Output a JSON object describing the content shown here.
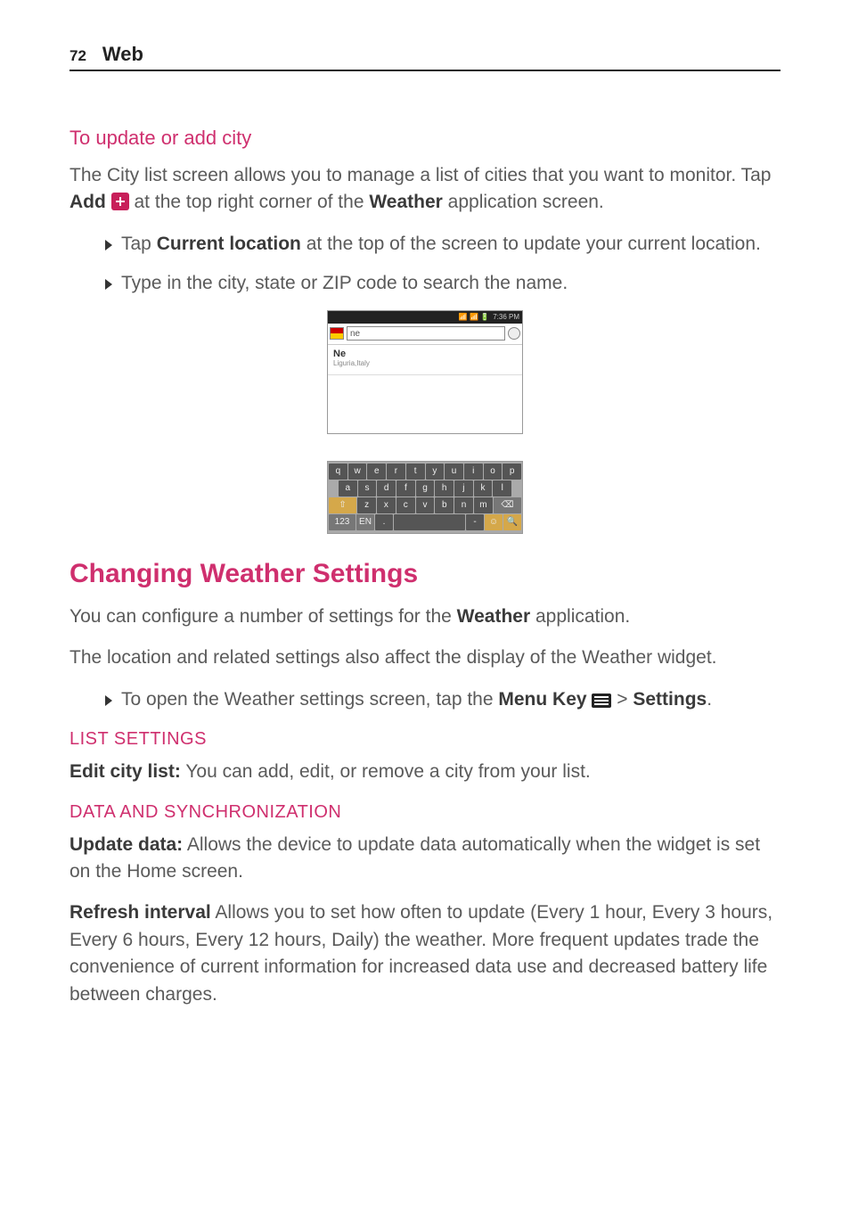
{
  "header": {
    "page_num": "72",
    "section": "Web"
  },
  "s1": {
    "title": "To update or add city",
    "p1a": "The City list screen allows you to manage a list of cities that you want to monitor. Tap ",
    "p1b": "Add",
    "p1c": " at the top right corner of the ",
    "p1d": "Weather",
    "p1e": " application screen.",
    "b1a": "Tap ",
    "b1b": "Current location",
    "b1c": " at the top of the screen to update your current location.",
    "b2": "Type in the city, state or ZIP code to search the name."
  },
  "shot": {
    "time": "7:36 PM",
    "search_val": "ne",
    "result_title": "Ne",
    "result_sub": "Liguria,Italy",
    "keys_r1": [
      "q",
      "w",
      "e",
      "r",
      "t",
      "y",
      "u",
      "i",
      "o",
      "p"
    ],
    "keys_r2": [
      "a",
      "s",
      "d",
      "f",
      "g",
      "h",
      "j",
      "k",
      "l"
    ],
    "keys_r3": [
      "⇧",
      "z",
      "x",
      "c",
      "v",
      "b",
      "n",
      "m",
      "⌫"
    ],
    "keys_r4": [
      "123",
      "EN",
      ".",
      "",
      "-",
      "☺",
      "🔍"
    ]
  },
  "s2": {
    "title": "Changing Weather Settings",
    "p1a": "You can configure a number of settings for the ",
    "p1b": "Weather",
    "p1c": " application.",
    "p2": "The location and related settings also affect the display of the Weather widget.",
    "b1a": "To open the Weather settings screen, tap the ",
    "b1b": "Menu Key",
    "b1c": " > ",
    "b1d": "Settings",
    "b1e": "."
  },
  "s3": {
    "title": "LIST SETTINGS",
    "p1a": "Edit city list:",
    "p1b": " You can add, edit, or remove a city from your list."
  },
  "s4": {
    "title": "DATA AND SYNCHRONIZATION",
    "p1a": "Update data:",
    "p1b": " Allows the device to update data automatically when the widget is set on the Home screen.",
    "p2a": "Refresh interval",
    "p2b": " Allows you to set how often to update (Every 1 hour, Every 3 hours, Every 6 hours, Every 12 hours, Daily) the weather. More frequent updates trade the convenience of current information for increased data use and decreased battery life between charges."
  }
}
